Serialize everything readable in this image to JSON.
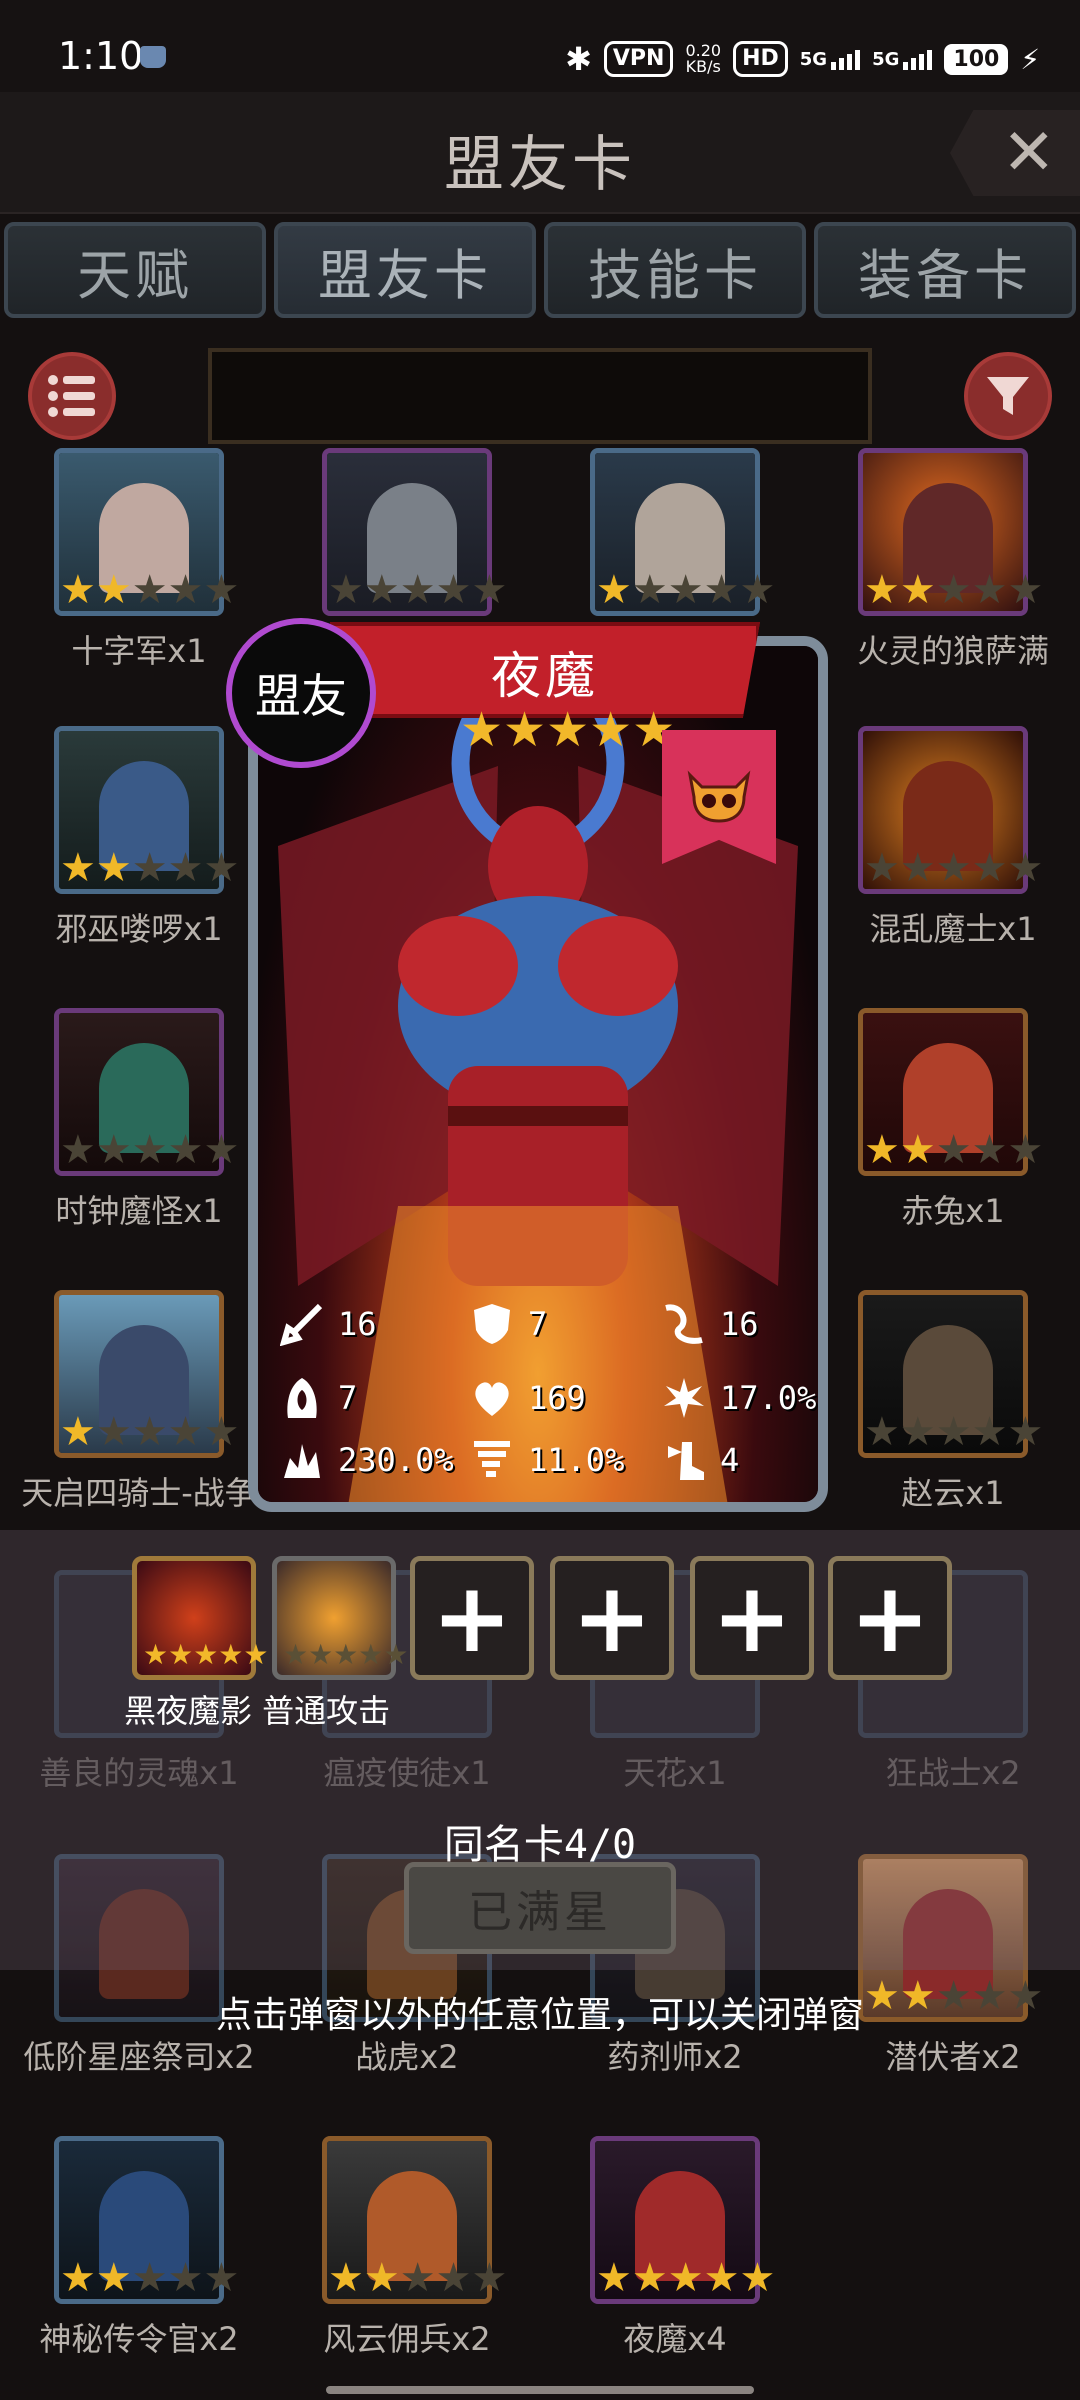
{
  "status_bar": {
    "time": "1:10",
    "vpn": "VPN",
    "speed_value": "0.20",
    "speed_unit": "KB/s",
    "hd": "HD",
    "net1": "5G",
    "net2": "5G",
    "battery": "100"
  },
  "header": {
    "title": "盟友卡",
    "close_symbol": "✕"
  },
  "tabs": [
    {
      "label": "天赋"
    },
    {
      "label": "盟友卡"
    },
    {
      "label": "技能卡"
    },
    {
      "label": "装备卡"
    }
  ],
  "active_tab": "盟友卡",
  "grid": {
    "row1": [
      "十字军x1",
      "",
      "",
      "火灵的狼萨满"
    ],
    "row2": [
      "邪巫喽啰x1",
      "",
      "",
      "混乱魔士x1"
    ],
    "row3": [
      "时钟魔怪x1",
      "",
      "",
      "赤兔x1"
    ],
    "row4": [
      "天启四骑士-战争",
      "",
      "",
      "赵云x1"
    ],
    "row5": [
      "善良的灵魂x1",
      "瘟疫使徒x1",
      "天花x1",
      "狂战士x2"
    ],
    "row6": [
      "低阶星座祭司x2",
      "战虎x2",
      "药剂师x2",
      "潜伏者x2"
    ],
    "row7": [
      "神秘传令官x2",
      "风云佣兵x2",
      "夜魔x4"
    ]
  },
  "card": {
    "badge": "盟友",
    "name": "夜魔",
    "stars": 5,
    "star_glyphs": "★★★★★",
    "stats": {
      "attack": "16",
      "defense": "7",
      "speed": "16",
      "dodge": "7",
      "hp": "169",
      "crit_rate": "17.0%",
      "crit_damage": "230.0%",
      "lifesteal": "11.0%",
      "move": "4"
    }
  },
  "skills": {
    "slot_symbol": "+",
    "label": "黑夜魔影 普通攻击"
  },
  "same_name": "同名卡4/0",
  "max_button": "已满星",
  "hint": "点击弹窗以外的任意位置，可以关闭弹窗"
}
